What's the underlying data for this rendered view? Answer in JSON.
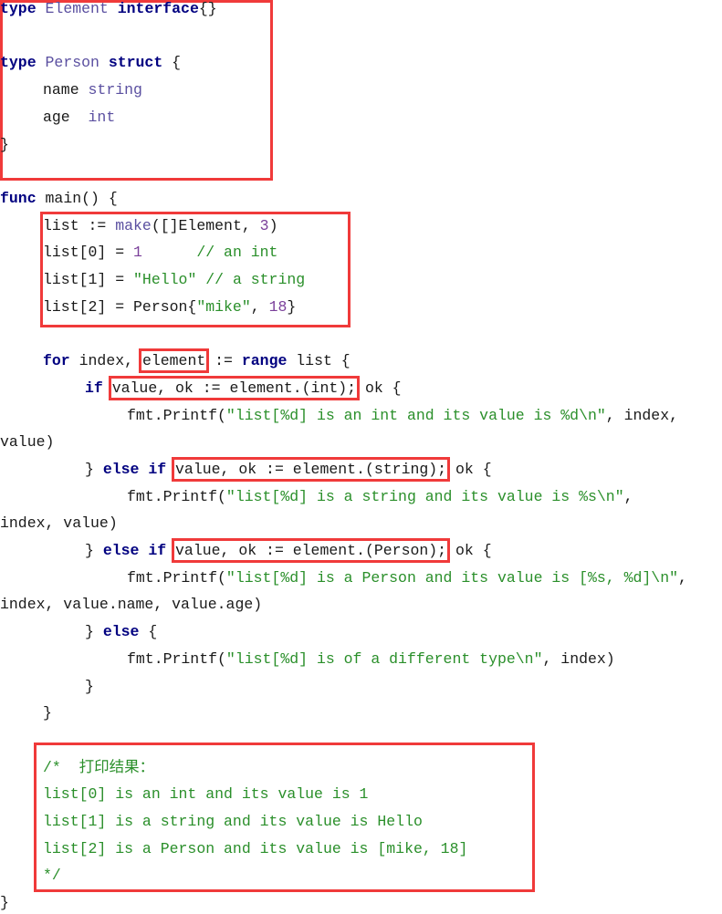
{
  "accent_colors": {
    "keyword": "#000080",
    "type": "#5a4fa0",
    "string": "#2a8f2a",
    "number": "#7a3f9a",
    "highlight_box": "#f03a3a"
  },
  "code_lines": [
    {
      "indent": 0,
      "tokens": [
        {
          "t": "type",
          "c": "k"
        },
        {
          "t": " Element ",
          "c": "ty"
        },
        {
          "t": "interface",
          "c": "k"
        },
        {
          "t": "{}",
          "c": "p"
        }
      ]
    },
    {
      "indent": 0,
      "tokens": []
    },
    {
      "indent": 0,
      "tokens": [
        {
          "t": "type",
          "c": "k"
        },
        {
          "t": " Person ",
          "c": "ty"
        },
        {
          "t": "struct",
          "c": "k"
        },
        {
          "t": " {",
          "c": "p"
        }
      ]
    },
    {
      "indent": 1,
      "tokens": [
        {
          "t": "name ",
          "c": "p"
        },
        {
          "t": "string",
          "c": "ty"
        }
      ]
    },
    {
      "indent": 1,
      "tokens": [
        {
          "t": "age  ",
          "c": "p"
        },
        {
          "t": "int",
          "c": "ty"
        }
      ]
    },
    {
      "indent": 0,
      "tokens": [
        {
          "t": "}",
          "c": "p"
        }
      ]
    },
    {
      "indent": 0,
      "tokens": []
    },
    {
      "indent": 0,
      "tokens": [
        {
          "t": "func",
          "c": "k"
        },
        {
          "t": " main() {",
          "c": "p"
        }
      ]
    },
    {
      "indent": 1,
      "tokens": [
        {
          "t": "list := ",
          "c": "p"
        },
        {
          "t": "make",
          "c": "ty"
        },
        {
          "t": "([]Element, ",
          "c": "p"
        },
        {
          "t": "3",
          "c": "n"
        },
        {
          "t": ")",
          "c": "p"
        }
      ]
    },
    {
      "indent": 1,
      "tokens": [
        {
          "t": "list[0] = ",
          "c": "p"
        },
        {
          "t": "1",
          "c": "n"
        },
        {
          "t": "      // an int",
          "c": "cm"
        }
      ]
    },
    {
      "indent": 1,
      "tokens": [
        {
          "t": "list[1] = ",
          "c": "p"
        },
        {
          "t": "\"Hello\"",
          "c": "s"
        },
        {
          "t": " // a string",
          "c": "cm"
        }
      ]
    },
    {
      "indent": 1,
      "tokens": [
        {
          "t": "list[2] = Person{",
          "c": "p"
        },
        {
          "t": "\"mike\"",
          "c": "s"
        },
        {
          "t": ", ",
          "c": "p"
        },
        {
          "t": "18",
          "c": "n"
        },
        {
          "t": "}",
          "c": "p"
        }
      ]
    },
    {
      "indent": 0,
      "tokens": []
    },
    {
      "indent": 1,
      "tokens": [
        {
          "t": "for",
          "c": "k"
        },
        {
          "t": " index, ",
          "c": "p"
        },
        {
          "t": "element",
          "c": "p",
          "b": true
        },
        {
          "t": " := ",
          "c": "p"
        },
        {
          "t": "range",
          "c": "k"
        },
        {
          "t": " list {",
          "c": "p"
        }
      ]
    },
    {
      "indent": 2,
      "tokens": [
        {
          "t": "if",
          "c": "k"
        },
        {
          "t": " ",
          "c": "p"
        },
        {
          "t": "value, ok := element.(int);",
          "c": "p",
          "b": true
        },
        {
          "t": " ok {",
          "c": "p"
        }
      ]
    },
    {
      "indent": 3,
      "tokens": [
        {
          "t": "fmt.Printf(",
          "c": "p"
        },
        {
          "t": "\"list[%d] is an int and its value is %d\\n\"",
          "c": "s"
        },
        {
          "t": ", index,",
          "c": "p"
        }
      ]
    },
    {
      "indent": 0,
      "tokens": [
        {
          "t": "value)",
          "c": "p"
        }
      ]
    },
    {
      "indent": 2,
      "tokens": [
        {
          "t": "} ",
          "c": "p"
        },
        {
          "t": "else if",
          "c": "k"
        },
        {
          "t": " ",
          "c": "p"
        },
        {
          "t": "value, ok := element.(string);",
          "c": "p",
          "b": true
        },
        {
          "t": " ok {",
          "c": "p"
        }
      ]
    },
    {
      "indent": 3,
      "tokens": [
        {
          "t": "fmt.Printf(",
          "c": "p"
        },
        {
          "t": "\"list[%d] is a string and its value is %s\\n\"",
          "c": "s"
        },
        {
          "t": ",",
          "c": "p"
        }
      ]
    },
    {
      "indent": 0,
      "tokens": [
        {
          "t": "index, value)",
          "c": "p"
        }
      ]
    },
    {
      "indent": 2,
      "tokens": [
        {
          "t": "} ",
          "c": "p"
        },
        {
          "t": "else if",
          "c": "k"
        },
        {
          "t": " ",
          "c": "p"
        },
        {
          "t": "value, ok := element.(Person);",
          "c": "p",
          "b": true
        },
        {
          "t": " ok {",
          "c": "p"
        }
      ]
    },
    {
      "indent": 3,
      "tokens": [
        {
          "t": "fmt.Printf(",
          "c": "p"
        },
        {
          "t": "\"list[%d] is a Person and its value is [%s, %d]\\n\"",
          "c": "s"
        },
        {
          "t": ",",
          "c": "p"
        }
      ]
    },
    {
      "indent": 0,
      "tokens": [
        {
          "t": "index, value.name, value.age)",
          "c": "p"
        }
      ]
    },
    {
      "indent": 2,
      "tokens": [
        {
          "t": "} ",
          "c": "p"
        },
        {
          "t": "else",
          "c": "k"
        },
        {
          "t": " {",
          "c": "p"
        }
      ]
    },
    {
      "indent": 3,
      "tokens": [
        {
          "t": "fmt.Printf(",
          "c": "p"
        },
        {
          "t": "\"list[%d] is of a different type\\n\"",
          "c": "s"
        },
        {
          "t": ", index)",
          "c": "p"
        }
      ]
    },
    {
      "indent": 2,
      "tokens": [
        {
          "t": "}",
          "c": "p"
        }
      ]
    },
    {
      "indent": 1,
      "tokens": [
        {
          "t": "}",
          "c": "p"
        }
      ]
    },
    {
      "indent": 0,
      "tokens": []
    },
    {
      "indent": 1,
      "tokens": [
        {
          "t": "/*  打印结果：",
          "c": "cm"
        }
      ]
    },
    {
      "indent": 1,
      "tokens": [
        {
          "t": "list[0] is an int and its value is 1",
          "c": "cm"
        }
      ]
    },
    {
      "indent": 1,
      "tokens": [
        {
          "t": "list[1] is a string and its value is Hello",
          "c": "cm"
        }
      ]
    },
    {
      "indent": 1,
      "tokens": [
        {
          "t": "list[2] is a Person and its value is [mike, 18]",
          "c": "cm"
        }
      ]
    },
    {
      "indent": 1,
      "tokens": [
        {
          "t": "*/",
          "c": "cm"
        }
      ]
    },
    {
      "indent": 0,
      "tokens": [
        {
          "t": "}",
          "c": "p"
        }
      ]
    }
  ]
}
